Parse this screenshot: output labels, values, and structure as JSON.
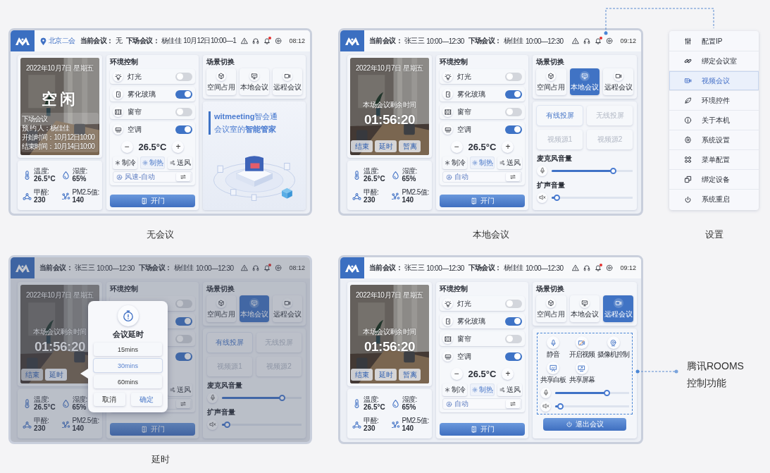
{
  "screens": [
    {
      "caption": "无会议",
      "header": {
        "location": "北京二会",
        "meetings": [
          {
            "label": "当前会议：",
            "parts": [
              "无"
            ]
          },
          {
            "label": "下场会议：",
            "parts": [
              "杨佳佳",
              "10月12日10:00—1"
            ]
          }
        ],
        "bell_badge": true,
        "time": "08:12"
      },
      "photo": {
        "kind": "idle",
        "date": "2022年10月7日 星期五",
        "status": "空闲",
        "info": [
          "下场会议",
          "预 约 人：杨佳佳",
          "开始时间：10月12日10:00",
          "结束时间：10月14日10:00"
        ]
      },
      "sensors": [
        {
          "label": "温度:",
          "value": "26.5°C"
        },
        {
          "label": "湿度:",
          "value": "65%"
        },
        {
          "label": "甲醛:",
          "value": "230"
        },
        {
          "label": "PM2.5值:",
          "value": "140"
        }
      ],
      "env": {
        "title": "环境控制",
        "rows": [
          {
            "label": "灯光",
            "on": false
          },
          {
            "label": "雾化玻璃",
            "on": true
          },
          {
            "label": "窗帘",
            "on": false
          }
        ],
        "ac": {
          "label": "空调",
          "on": true,
          "decrease": "−",
          "temperature": "26.5°C",
          "increase": "+",
          "modes": [
            {
              "label": "制冷",
              "selected": false
            },
            {
              "label": "制热",
              "selected": true
            },
            {
              "label": "送风",
              "selected": false
            }
          ],
          "fan": "风速-自动"
        },
        "door_button": "开门"
      },
      "scenes": {
        "title": "场景切换",
        "items": [
          {
            "label": "空间占用",
            "selected": false
          },
          {
            "label": "本地会议",
            "selected": false
          },
          {
            "label": "远程会议",
            "selected": false
          }
        ]
      },
      "lower": {
        "kind": "promo",
        "headline": "**witmeeting**智会通",
        "tagline": "会议室的**智能管家**"
      }
    },
    {
      "caption": "本地会议",
      "header": {
        "meetings": [
          {
            "label": "当前会议：",
            "parts": [
              "张三三",
              "10:00—12:30"
            ]
          },
          {
            "label": "下场会议：",
            "parts": [
              "杨佳佳",
              "10:00—12:30"
            ]
          }
        ],
        "bell_badge": true,
        "time": "09:12"
      },
      "photo": {
        "kind": "countdown",
        "date": "2022年10月7日 星期五",
        "countdown_label": "本场会议剩余时间",
        "countdown": "01:56:20",
        "buttons": [
          {
            "label": "结束",
            "selected": false
          },
          {
            "label": "延时",
            "selected": false
          },
          {
            "label": "暂离",
            "selected": false
          }
        ]
      },
      "sensors": [
        {
          "label": "温度:",
          "value": "26.5°C"
        },
        {
          "label": "湿度:",
          "value": "65%"
        },
        {
          "label": "甲醛:",
          "value": "230"
        },
        {
          "label": "PM2.5值:",
          "value": "140"
        }
      ],
      "env": {
        "title": "环境控制",
        "rows": [
          {
            "label": "灯光",
            "on": false
          },
          {
            "label": "雾化玻璃",
            "on": true
          },
          {
            "label": "窗帘",
            "on": false
          }
        ],
        "ac": {
          "label": "空调",
          "on": true,
          "decrease": "−",
          "temperature": "26.5°C",
          "increase": "+",
          "modes": [
            {
              "label": "制冷",
              "selected": false
            },
            {
              "label": "制热",
              "selected": true
            },
            {
              "label": "送风",
              "selected": false
            }
          ],
          "fan": "自动"
        },
        "door_button": "开门"
      },
      "scenes": {
        "title": "场景切换",
        "items": [
          {
            "label": "空间占用",
            "selected": false
          },
          {
            "label": "本地会议",
            "selected": true
          },
          {
            "label": "远程会议",
            "selected": false
          }
        ]
      },
      "lower": {
        "kind": "local",
        "sources": [
          {
            "label": "有线投屏",
            "selected": true
          },
          {
            "label": "无线投屏",
            "selected": false
          },
          {
            "label": "视频源1",
            "selected": false
          },
          {
            "label": "视频源2",
            "selected": false
          }
        ],
        "sliders": [
          {
            "label": "麦克风音量",
            "level": 0.78
          },
          {
            "label": "扩声音量",
            "level": 0.03
          }
        ]
      }
    },
    {
      "caption": "延时",
      "header": {
        "meetings": [
          {
            "label": "当前会议：",
            "parts": [
              "张三三",
              "10:00—12:30"
            ]
          },
          {
            "label": "下场会议：",
            "parts": [
              "杨佳佳",
              "10:00—12:30"
            ]
          }
        ],
        "bell_badge": true,
        "time": "08:12"
      },
      "photo": {
        "kind": "countdown",
        "date": "2022年10月7日 星期五",
        "countdown_label": "本场会议剩余时间",
        "countdown": "01:56:20",
        "buttons": [
          {
            "label": "结束",
            "selected": false
          },
          {
            "label": "延时",
            "selected": true
          }
        ]
      },
      "sensors": [
        {
          "label": "温度:",
          "value": "26.5°C"
        },
        {
          "label": "湿度:",
          "value": "65%"
        },
        {
          "label": "甲醛:",
          "value": "230"
        },
        {
          "label": "PM2.5值:",
          "value": "140"
        }
      ],
      "env": {
        "title": "环境控制",
        "rows": [
          {
            "on": false
          },
          {
            "on": true
          },
          {
            "on": false
          }
        ],
        "ac": {
          "on": true,
          "modes": [
            {
              "label": "送风",
              "selected": false
            }
          ]
        },
        "door_button": "开门"
      },
      "scenes": {
        "title": "场景切换",
        "items": [
          {
            "label": "空间占用",
            "selected": false
          },
          {
            "label": "本地会议",
            "selected": true
          },
          {
            "label": "远程会议",
            "selected": false
          }
        ]
      },
      "lower": {
        "kind": "local",
        "sources": [
          {
            "label": "有线投屏",
            "selected": true
          },
          {
            "label": "无线投屏",
            "selected": false
          },
          {
            "label": "视频源1",
            "selected": false
          },
          {
            "label": "视频源2",
            "selected": false
          }
        ],
        "sliders": [
          {
            "label": "麦克风音量",
            "level": 0.78
          },
          {
            "label": "扩声音量",
            "level": 0.03
          }
        ]
      },
      "dialog": {
        "title": "会议延时",
        "options": [
          {
            "label": "15mins",
            "selected": false
          },
          {
            "label": "30mins",
            "selected": true
          },
          {
            "label": "60mins",
            "selected": false
          }
        ],
        "buttons": [
          {
            "label": "取消",
            "kind": "secondary"
          },
          {
            "label": "确定",
            "kind": "primary"
          }
        ]
      }
    },
    {
      "header": {
        "meetings": [
          {
            "label": "当前会议：",
            "parts": [
              "张三三",
              "10:00—12:30"
            ]
          },
          {
            "label": "下场会议：",
            "parts": [
              "杨佳佳",
              "10:00—12:30"
            ]
          }
        ],
        "bell_badge": true,
        "time": "09:12"
      },
      "photo": {
        "kind": "countdown",
        "date": "2022年10月7日 星期五",
        "countdown_label": "本场会议剩余时间",
        "countdown": "01:56:20",
        "buttons": [
          {
            "label": "结束",
            "selected": false
          },
          {
            "label": "延时",
            "selected": false
          },
          {
            "label": "暂离",
            "selected": false
          }
        ]
      },
      "sensors": [
        {
          "label": "温度:",
          "value": "26.5°C"
        },
        {
          "label": "湿度:",
          "value": "65%"
        },
        {
          "label": "甲醛:",
          "value": "230"
        },
        {
          "label": "PM2.5值:",
          "value": "140"
        }
      ],
      "env": {
        "title": "环境控制",
        "rows": [
          {
            "label": "灯光",
            "on": false
          },
          {
            "label": "雾化玻璃",
            "on": true
          },
          {
            "label": "窗帘",
            "on": false
          }
        ],
        "ac": {
          "label": "空调",
          "on": true,
          "decrease": "−",
          "temperature": "26.5°C",
          "increase": "+",
          "modes": [
            {
              "label": "制冷",
              "selected": false
            },
            {
              "label": "制热",
              "selected": true
            },
            {
              "label": "送风",
              "selected": false
            }
          ],
          "fan": "自动"
        },
        "door_button": "开门"
      },
      "scenes": {
        "title": "场景切换",
        "items": [
          {
            "label": "空间占用",
            "selected": false
          },
          {
            "label": "本地会议",
            "selected": false
          },
          {
            "label": "远程会议",
            "selected": true
          }
        ]
      },
      "lower": {
        "kind": "rooms",
        "controls": [
          {
            "label": "静音"
          },
          {
            "label": "开启视频"
          },
          {
            "label": "摄像机控制"
          },
          {
            "label": "共享白板"
          },
          {
            "label": "共享屏幕"
          }
        ],
        "sliders": [
          {
            "level": 0.72
          },
          {
            "level": 0.03
          }
        ],
        "exit_button": "退出会议"
      }
    }
  ],
  "settings_menu": {
    "caption": "设置",
    "items": [
      {
        "label": "配置IP",
        "selected": false
      },
      {
        "label": "绑定会议室",
        "selected": false
      },
      {
        "label": "视频会议",
        "selected": true
      },
      {
        "label": "环境控件",
        "selected": false
      },
      {
        "label": "关于本机",
        "selected": false
      },
      {
        "label": "系统设置",
        "selected": false
      },
      {
        "label": "菜单配置",
        "selected": false
      },
      {
        "label": "绑定设备",
        "selected": false
      },
      {
        "label": "系统重启",
        "selected": false
      }
    ]
  },
  "callout": {
    "lines": [
      "腾讯ROOMS",
      "控制功能"
    ]
  }
}
